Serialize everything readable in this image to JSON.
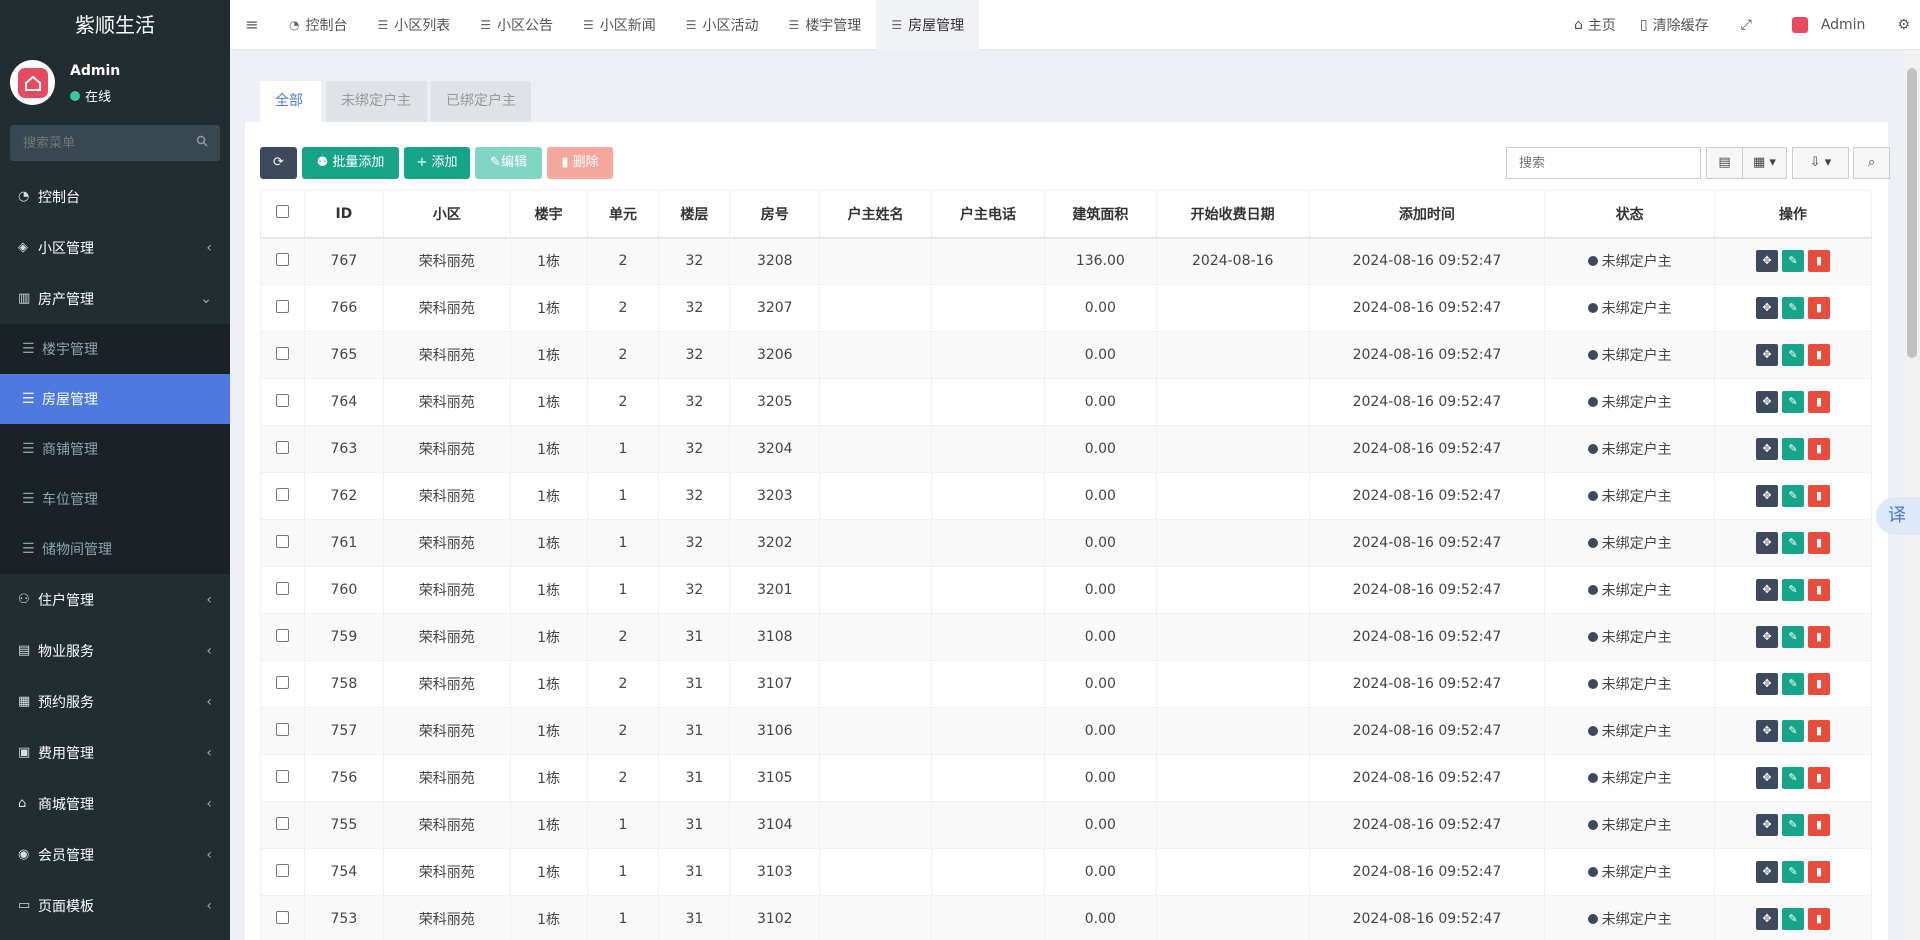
{
  "sidebar": {
    "brand": "紫顺生活",
    "user": {
      "name": "Admin",
      "status": "在线"
    },
    "search_placeholder": "搜索菜单",
    "menus": [
      {
        "label": "控制台",
        "icon": "dashboard-icon",
        "glyph": "◔",
        "has_children": false
      },
      {
        "label": "小区管理",
        "icon": "cube-icon",
        "glyph": "◈",
        "has_children": true
      },
      {
        "label": "房产管理",
        "icon": "building-icon",
        "glyph": "▥",
        "has_children": true,
        "expanded": true
      }
    ],
    "submenus": [
      {
        "label": "楼宇管理",
        "active": false
      },
      {
        "label": "房屋管理",
        "active": true
      },
      {
        "label": "商铺管理",
        "active": false
      },
      {
        "label": "车位管理",
        "active": false
      },
      {
        "label": "储物间管理",
        "active": false
      }
    ],
    "menus_after": [
      {
        "label": "住户管理",
        "icon": "user-icon",
        "glyph": "⚇"
      },
      {
        "label": "物业服务",
        "icon": "server-icon",
        "glyph": "▤"
      },
      {
        "label": "预约服务",
        "icon": "calendar-icon",
        "glyph": "▦"
      },
      {
        "label": "费用管理",
        "icon": "bill-icon",
        "glyph": "▣"
      },
      {
        "label": "商城管理",
        "icon": "shop-icon",
        "glyph": "⌂"
      },
      {
        "label": "会员管理",
        "icon": "member-icon",
        "glyph": "◉"
      },
      {
        "label": "页面模板",
        "icon": "template-icon",
        "glyph": "▭"
      }
    ]
  },
  "topbar": {
    "tabs": [
      "控制台",
      "小区列表",
      "小区公告",
      "小区新闻",
      "小区活动",
      "楼宇管理",
      "房屋管理"
    ],
    "active_tab": "房屋管理",
    "home": "主页",
    "clear_cache": "清除缓存",
    "admin": "Admin"
  },
  "content": {
    "nav_tabs": [
      "全部",
      "未绑定户主",
      "已绑定户主"
    ],
    "active_nav_tab": "全部",
    "buttons": {
      "batch_add": "批量添加",
      "add": "添加",
      "edit": "编辑",
      "delete": "删除"
    },
    "search_placeholder": "搜索",
    "columns": [
      "ID",
      "小区",
      "楼宇",
      "单元",
      "楼层",
      "房号",
      "户主姓名",
      "户主电话",
      "建筑面积",
      "开始收费日期",
      "添加时间",
      "状态",
      "操作"
    ],
    "rows": [
      [
        "767",
        "荣科丽苑",
        "1栋",
        "2",
        "32",
        "3208",
        "",
        "",
        "136.00",
        "2024-08-16",
        "2024-08-16 09:52:47",
        "未绑定户主"
      ],
      [
        "766",
        "荣科丽苑",
        "1栋",
        "2",
        "32",
        "3207",
        "",
        "",
        "0.00",
        "",
        "2024-08-16 09:52:47",
        "未绑定户主"
      ],
      [
        "765",
        "荣科丽苑",
        "1栋",
        "2",
        "32",
        "3206",
        "",
        "",
        "0.00",
        "",
        "2024-08-16 09:52:47",
        "未绑定户主"
      ],
      [
        "764",
        "荣科丽苑",
        "1栋",
        "2",
        "32",
        "3205",
        "",
        "",
        "0.00",
        "",
        "2024-08-16 09:52:47",
        "未绑定户主"
      ],
      [
        "763",
        "荣科丽苑",
        "1栋",
        "1",
        "32",
        "3204",
        "",
        "",
        "0.00",
        "",
        "2024-08-16 09:52:47",
        "未绑定户主"
      ],
      [
        "762",
        "荣科丽苑",
        "1栋",
        "1",
        "32",
        "3203",
        "",
        "",
        "0.00",
        "",
        "2024-08-16 09:52:47",
        "未绑定户主"
      ],
      [
        "761",
        "荣科丽苑",
        "1栋",
        "1",
        "32",
        "3202",
        "",
        "",
        "0.00",
        "",
        "2024-08-16 09:52:47",
        "未绑定户主"
      ],
      [
        "760",
        "荣科丽苑",
        "1栋",
        "1",
        "32",
        "3201",
        "",
        "",
        "0.00",
        "",
        "2024-08-16 09:52:47",
        "未绑定户主"
      ],
      [
        "759",
        "荣科丽苑",
        "1栋",
        "2",
        "31",
        "3108",
        "",
        "",
        "0.00",
        "",
        "2024-08-16 09:52:47",
        "未绑定户主"
      ],
      [
        "758",
        "荣科丽苑",
        "1栋",
        "2",
        "31",
        "3107",
        "",
        "",
        "0.00",
        "",
        "2024-08-16 09:52:47",
        "未绑定户主"
      ],
      [
        "757",
        "荣科丽苑",
        "1栋",
        "2",
        "31",
        "3106",
        "",
        "",
        "0.00",
        "",
        "2024-08-16 09:52:47",
        "未绑定户主"
      ],
      [
        "756",
        "荣科丽苑",
        "1栋",
        "2",
        "31",
        "3105",
        "",
        "",
        "0.00",
        "",
        "2024-08-16 09:52:47",
        "未绑定户主"
      ],
      [
        "755",
        "荣科丽苑",
        "1栋",
        "1",
        "31",
        "3104",
        "",
        "",
        "0.00",
        "",
        "2024-08-16 09:52:47",
        "未绑定户主"
      ],
      [
        "754",
        "荣科丽苑",
        "1栋",
        "1",
        "31",
        "3103",
        "",
        "",
        "0.00",
        "",
        "2024-08-16 09:52:47",
        "未绑定户主"
      ],
      [
        "753",
        "荣科丽苑",
        "1栋",
        "1",
        "31",
        "3102",
        "",
        "",
        "0.00",
        "",
        "2024-08-16 09:52:47",
        "未绑定户主"
      ]
    ]
  },
  "translate_label": "译",
  "colors": {
    "sidebar_bg": "#222d32",
    "accent": "#4d79e0",
    "success": "#17a589",
    "danger": "#e74c3c",
    "dark": "#3d4a5d"
  }
}
